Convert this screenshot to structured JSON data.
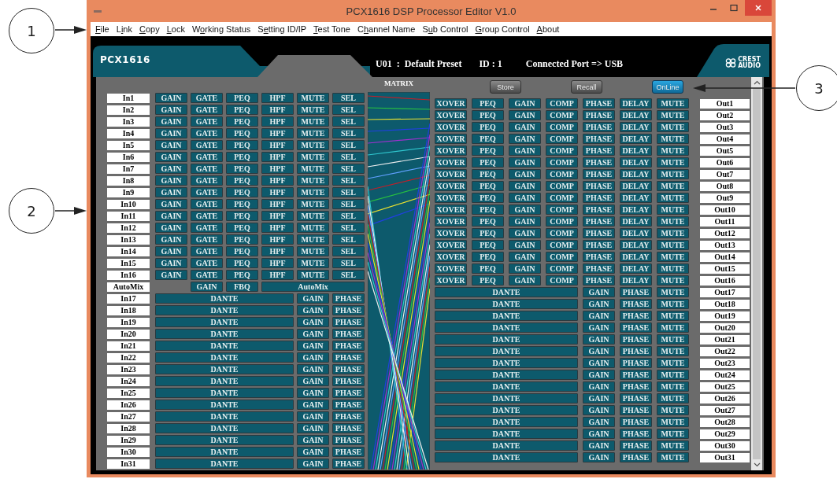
{
  "window": {
    "title": "PCX1616 DSP Processor Editor V1.0",
    "menu": [
      {
        "key": "F",
        "post": "ile"
      },
      {
        "pre": "L",
        "key": "i",
        "post": "nk"
      },
      {
        "key": "C",
        "post": "opy"
      },
      {
        "key": "L",
        "post": "ock"
      },
      {
        "pre": "W",
        "key": "o",
        "post": "rking Status"
      },
      {
        "pre": "S",
        "key": "e",
        "post": "tting ID/IP"
      },
      {
        "key": "T",
        "post": "est Tone"
      },
      {
        "pre": "C",
        "key": "h",
        "post": "annel Name"
      },
      {
        "pre": "S",
        "key": "u",
        "post": "b Control"
      },
      {
        "key": "G",
        "post": "roup Control"
      },
      {
        "key": "A",
        "post": "bout"
      }
    ]
  },
  "header": {
    "model": "PCX1616",
    "preset": "U01  :  Default Preset",
    "id": "ID : 1",
    "port": "Connected Port => USB",
    "logo": [
      "CREST",
      "AUDIO"
    ]
  },
  "matrix": {
    "title": "MATRIX"
  },
  "actions": [
    {
      "label": "Store",
      "on": false
    },
    {
      "label": "Recall",
      "on": false
    },
    {
      "label": "OnLine",
      "on": true
    }
  ],
  "inputs": [
    {
      "kind": "dsp",
      "name": "In1",
      "controls": [
        "GAIN",
        "GATE",
        "PEQ",
        "HPF",
        "MUTE",
        "SEL"
      ]
    },
    {
      "kind": "dsp",
      "name": "In2",
      "controls": [
        "GAIN",
        "GATE",
        "PEQ",
        "HPF",
        "MUTE",
        "SEL"
      ]
    },
    {
      "kind": "dsp",
      "name": "In3",
      "controls": [
        "GAIN",
        "GATE",
        "PEQ",
        "HPF",
        "MUTE",
        "SEL"
      ]
    },
    {
      "kind": "dsp",
      "name": "In4",
      "controls": [
        "GAIN",
        "GATE",
        "PEQ",
        "HPF",
        "MUTE",
        "SEL"
      ]
    },
    {
      "kind": "dsp",
      "name": "In5",
      "controls": [
        "GAIN",
        "GATE",
        "PEQ",
        "HPF",
        "MUTE",
        "SEL"
      ]
    },
    {
      "kind": "dsp",
      "name": "In6",
      "controls": [
        "GAIN",
        "GATE",
        "PEQ",
        "HPF",
        "MUTE",
        "SEL"
      ]
    },
    {
      "kind": "dsp",
      "name": "In7",
      "controls": [
        "GAIN",
        "GATE",
        "PEQ",
        "HPF",
        "MUTE",
        "SEL"
      ]
    },
    {
      "kind": "dsp",
      "name": "In8",
      "controls": [
        "GAIN",
        "GATE",
        "PEQ",
        "HPF",
        "MUTE",
        "SEL"
      ]
    },
    {
      "kind": "dsp",
      "name": "In9",
      "controls": [
        "GAIN",
        "GATE",
        "PEQ",
        "HPF",
        "MUTE",
        "SEL"
      ]
    },
    {
      "kind": "dsp",
      "name": "In10",
      "controls": [
        "GAIN",
        "GATE",
        "PEQ",
        "HPF",
        "MUTE",
        "SEL"
      ]
    },
    {
      "kind": "dsp",
      "name": "In11",
      "controls": [
        "GAIN",
        "GATE",
        "PEQ",
        "HPF",
        "MUTE",
        "SEL"
      ]
    },
    {
      "kind": "dsp",
      "name": "In12",
      "controls": [
        "GAIN",
        "GATE",
        "PEQ",
        "HPF",
        "MUTE",
        "SEL"
      ]
    },
    {
      "kind": "dsp",
      "name": "In13",
      "controls": [
        "GAIN",
        "GATE",
        "PEQ",
        "HPF",
        "MUTE",
        "SEL"
      ]
    },
    {
      "kind": "dsp",
      "name": "In14",
      "controls": [
        "GAIN",
        "GATE",
        "PEQ",
        "HPF",
        "MUTE",
        "SEL"
      ]
    },
    {
      "kind": "dsp",
      "name": "In15",
      "controls": [
        "GAIN",
        "GATE",
        "PEQ",
        "HPF",
        "MUTE",
        "SEL"
      ]
    },
    {
      "kind": "dsp",
      "name": "In16",
      "controls": [
        "GAIN",
        "GATE",
        "PEQ",
        "HPF",
        "MUTE",
        "SEL"
      ]
    },
    {
      "kind": "automix",
      "name": "AutoMix",
      "controls": [
        "GAIN",
        "FBQ",
        "AutoMix"
      ]
    },
    {
      "kind": "dante",
      "name": "In17",
      "controls": [
        "DANTE",
        "GAIN",
        "PHASE"
      ]
    },
    {
      "kind": "dante",
      "name": "In18",
      "controls": [
        "DANTE",
        "GAIN",
        "PHASE"
      ]
    },
    {
      "kind": "dante",
      "name": "In19",
      "controls": [
        "DANTE",
        "GAIN",
        "PHASE"
      ]
    },
    {
      "kind": "dante",
      "name": "In20",
      "controls": [
        "DANTE",
        "GAIN",
        "PHASE"
      ]
    },
    {
      "kind": "dante",
      "name": "In21",
      "controls": [
        "DANTE",
        "GAIN",
        "PHASE"
      ]
    },
    {
      "kind": "dante",
      "name": "In22",
      "controls": [
        "DANTE",
        "GAIN",
        "PHASE"
      ]
    },
    {
      "kind": "dante",
      "name": "In23",
      "controls": [
        "DANTE",
        "GAIN",
        "PHASE"
      ]
    },
    {
      "kind": "dante",
      "name": "In24",
      "controls": [
        "DANTE",
        "GAIN",
        "PHASE"
      ]
    },
    {
      "kind": "dante",
      "name": "In25",
      "controls": [
        "DANTE",
        "GAIN",
        "PHASE"
      ]
    },
    {
      "kind": "dante",
      "name": "In26",
      "controls": [
        "DANTE",
        "GAIN",
        "PHASE"
      ]
    },
    {
      "kind": "dante",
      "name": "In27",
      "controls": [
        "DANTE",
        "GAIN",
        "PHASE"
      ]
    },
    {
      "kind": "dante",
      "name": "In28",
      "controls": [
        "DANTE",
        "GAIN",
        "PHASE"
      ]
    },
    {
      "kind": "dante",
      "name": "In29",
      "controls": [
        "DANTE",
        "GAIN",
        "PHASE"
      ]
    },
    {
      "kind": "dante",
      "name": "In30",
      "controls": [
        "DANTE",
        "GAIN",
        "PHASE"
      ]
    },
    {
      "kind": "dante",
      "name": "In31",
      "controls": [
        "DANTE",
        "GAIN",
        "PHASE"
      ]
    }
  ],
  "outputs": [
    {
      "kind": "dsp",
      "name": "Out1",
      "controls": [
        "XOVER",
        "PEQ",
        "GAIN",
        "COMP",
        "PHASE",
        "DELAY",
        "MUTE"
      ]
    },
    {
      "kind": "dsp",
      "name": "Out2",
      "controls": [
        "XOVER",
        "PEQ",
        "GAIN",
        "COMP",
        "PHASE",
        "DELAY",
        "MUTE"
      ]
    },
    {
      "kind": "dsp",
      "name": "Out3",
      "controls": [
        "XOVER",
        "PEQ",
        "GAIN",
        "COMP",
        "PHASE",
        "DELAY",
        "MUTE"
      ]
    },
    {
      "kind": "dsp",
      "name": "Out4",
      "controls": [
        "XOVER",
        "PEQ",
        "GAIN",
        "COMP",
        "PHASE",
        "DELAY",
        "MUTE"
      ]
    },
    {
      "kind": "dsp",
      "name": "Out5",
      "controls": [
        "XOVER",
        "PEQ",
        "GAIN",
        "COMP",
        "PHASE",
        "DELAY",
        "MUTE"
      ]
    },
    {
      "kind": "dsp",
      "name": "Out6",
      "controls": [
        "XOVER",
        "PEQ",
        "GAIN",
        "COMP",
        "PHASE",
        "DELAY",
        "MUTE"
      ]
    },
    {
      "kind": "dsp",
      "name": "Out7",
      "controls": [
        "XOVER",
        "PEQ",
        "GAIN",
        "COMP",
        "PHASE",
        "DELAY",
        "MUTE"
      ]
    },
    {
      "kind": "dsp",
      "name": "Out8",
      "controls": [
        "XOVER",
        "PEQ",
        "GAIN",
        "COMP",
        "PHASE",
        "DELAY",
        "MUTE"
      ]
    },
    {
      "kind": "dsp",
      "name": "Out9",
      "controls": [
        "XOVER",
        "PEQ",
        "GAIN",
        "COMP",
        "PHASE",
        "DELAY",
        "MUTE"
      ]
    },
    {
      "kind": "dsp",
      "name": "Out10",
      "controls": [
        "XOVER",
        "PEQ",
        "GAIN",
        "COMP",
        "PHASE",
        "DELAY",
        "MUTE"
      ]
    },
    {
      "kind": "dsp",
      "name": "Out11",
      "controls": [
        "XOVER",
        "PEQ",
        "GAIN",
        "COMP",
        "PHASE",
        "DELAY",
        "MUTE"
      ]
    },
    {
      "kind": "dsp",
      "name": "Out12",
      "controls": [
        "XOVER",
        "PEQ",
        "GAIN",
        "COMP",
        "PHASE",
        "DELAY",
        "MUTE"
      ]
    },
    {
      "kind": "dsp",
      "name": "Out13",
      "controls": [
        "XOVER",
        "PEQ",
        "GAIN",
        "COMP",
        "PHASE",
        "DELAY",
        "MUTE"
      ]
    },
    {
      "kind": "dsp",
      "name": "Out14",
      "controls": [
        "XOVER",
        "PEQ",
        "GAIN",
        "COMP",
        "PHASE",
        "DELAY",
        "MUTE"
      ]
    },
    {
      "kind": "dsp",
      "name": "Out15",
      "controls": [
        "XOVER",
        "PEQ",
        "GAIN",
        "COMP",
        "PHASE",
        "DELAY",
        "MUTE"
      ]
    },
    {
      "kind": "dsp",
      "name": "Out16",
      "controls": [
        "XOVER",
        "PEQ",
        "GAIN",
        "COMP",
        "PHASE",
        "DELAY",
        "MUTE"
      ]
    },
    {
      "kind": "dante",
      "name": "Out17",
      "controls": [
        "DANTE",
        "GAIN",
        "PHASE",
        "MUTE"
      ]
    },
    {
      "kind": "dante",
      "name": "Out18",
      "controls": [
        "DANTE",
        "GAIN",
        "PHASE",
        "MUTE"
      ]
    },
    {
      "kind": "dante",
      "name": "Out19",
      "controls": [
        "DANTE",
        "GAIN",
        "PHASE",
        "MUTE"
      ]
    },
    {
      "kind": "dante",
      "name": "Out20",
      "controls": [
        "DANTE",
        "GAIN",
        "PHASE",
        "MUTE"
      ]
    },
    {
      "kind": "dante",
      "name": "Out21",
      "controls": [
        "DANTE",
        "GAIN",
        "PHASE",
        "MUTE"
      ]
    },
    {
      "kind": "dante",
      "name": "Out22",
      "controls": [
        "DANTE",
        "GAIN",
        "PHASE",
        "MUTE"
      ]
    },
    {
      "kind": "dante",
      "name": "Out23",
      "controls": [
        "DANTE",
        "GAIN",
        "PHASE",
        "MUTE"
      ]
    },
    {
      "kind": "dante",
      "name": "Out24",
      "controls": [
        "DANTE",
        "GAIN",
        "PHASE",
        "MUTE"
      ]
    },
    {
      "kind": "dante",
      "name": "Out25",
      "controls": [
        "DANTE",
        "GAIN",
        "PHASE",
        "MUTE"
      ]
    },
    {
      "kind": "dante",
      "name": "Out26",
      "controls": [
        "DANTE",
        "GAIN",
        "PHASE",
        "MUTE"
      ]
    },
    {
      "kind": "dante",
      "name": "Out27",
      "controls": [
        "DANTE",
        "GAIN",
        "PHASE",
        "MUTE"
      ]
    },
    {
      "kind": "dante",
      "name": "Out28",
      "controls": [
        "DANTE",
        "GAIN",
        "PHASE",
        "MUTE"
      ]
    },
    {
      "kind": "dante",
      "name": "Out29",
      "controls": [
        "DANTE",
        "GAIN",
        "PHASE",
        "MUTE"
      ]
    },
    {
      "kind": "dante",
      "name": "Out30",
      "controls": [
        "DANTE",
        "GAIN",
        "PHASE",
        "MUTE"
      ]
    },
    {
      "kind": "dante",
      "name": "Out31",
      "controls": [
        "DANTE",
        "GAIN",
        "PHASE",
        "MUTE"
      ]
    }
  ],
  "callouts": [
    {
      "label": "1"
    },
    {
      "label": "2"
    },
    {
      "label": "3"
    }
  ]
}
